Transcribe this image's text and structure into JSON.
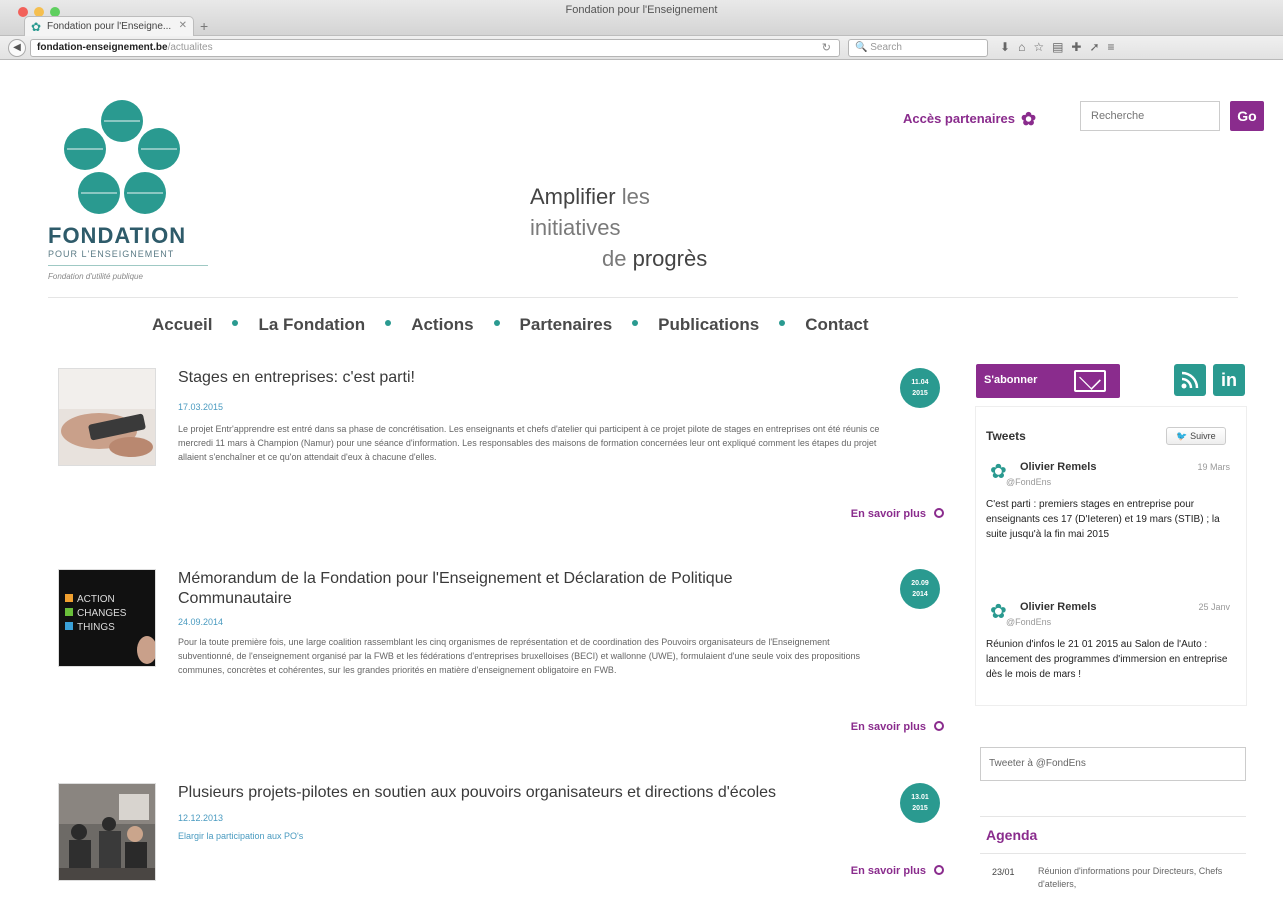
{
  "browser": {
    "window_title": "Fondation pour l'Enseignement",
    "tab_label": "Fondation pour l'Enseigne...",
    "url_host": "fondation-enseignement.be",
    "url_path": "/actualites",
    "search_placeholder": "Search"
  },
  "header": {
    "logo_name": "FONDATION",
    "logo_sub": "POUR L'ENSEIGNEMENT",
    "logo_tag": "Fondation d'utilité publique",
    "tagline_l1_strong": "Amplifier",
    "tagline_l1_rest": " les",
    "tagline_l2": "initiatives",
    "tagline_l3_pre": "de ",
    "tagline_l3_strong": "progrès",
    "partners_label": "Accès partenaires",
    "search_placeholder": "Recherche",
    "go_label": "Go"
  },
  "nav": {
    "items": [
      "Accueil",
      "La Fondation",
      "Actions",
      "Partenaires",
      "Publications",
      "Contact"
    ]
  },
  "articles": [
    {
      "title": "Stages en entreprises: c'est parti!",
      "date": "17.03.2015",
      "badge_l1": "11.04",
      "badge_l2": "2015",
      "body": "Le projet Entr'apprendre est entré dans sa phase de concrétisation. Les enseignants et chefs d'atelier qui participent à ce projet pilote de stages en entreprises ont été réunis ce mercredi 11 mars à Champion (Namur) pour une séance d'information. Les responsables des maisons de formation concernées leur ont expliqué comment les étapes du projet allaient s'enchaîner et ce qu'on attendait d'eux à chacune d'elles.",
      "more": "En savoir plus"
    },
    {
      "title": "Mémorandum de la Fondation pour l'Enseignement et Déclaration de Politique Communautaire",
      "date": "24.09.2014",
      "badge_l1": "20.09",
      "badge_l2": "2014",
      "body": "Pour la toute première fois, une large coalition rassemblant les cinq organismes de représentation et de coordination des Pouvoirs organisateurs de l'Enseignement subventionné, de l'enseignement organisé par la FWB et les fédérations d'entreprises bruxelloises (BECI) et wallonne (UWE), formulaient d'une seule voix des propositions communes, concrètes et cohérentes, sur les grandes priorités en matière d'enseignement obligatoire en FWB.",
      "more": "En savoir plus"
    },
    {
      "title": "Plusieurs projets-pilotes en soutien aux pouvoirs organisateurs et directions d'écoles",
      "date": "12.12.2013",
      "badge_l1": "13.01",
      "badge_l2": "2015",
      "link": "Elargir la participation aux PO's",
      "more": "En savoir plus"
    }
  ],
  "sidebar": {
    "subscribe_label": "S'abonner",
    "rss_label": "RSS",
    "linkedin_label": "in",
    "tweets_title": "Tweets",
    "follow_label": "Suivre",
    "tweets": [
      {
        "name": "Olivier Remels",
        "handle": "@FondEns",
        "date": "19 Mars",
        "text": "C'est parti : premiers stages en entreprise pour enseignants ces 17 (D'Ieteren) et 19 mars (STIB) ; la suite jusqu'à la fin mai 2015"
      },
      {
        "name": "Olivier Remels",
        "handle": "@FondEns",
        "date": "25 Janv",
        "text": "Réunion d'infos le 21 01 2015 au Salon de l'Auto : lancement des programmes d'immersion en entreprise dès le mois de mars !"
      }
    ],
    "tweet_box_label": "Tweeter à @FondEns",
    "agenda_title": "Agenda",
    "agenda_date": "23/01",
    "agenda_text": "Réunion d'informations pour Directeurs, Chefs d'ateliers,"
  },
  "colors": {
    "purple": "#8a2c8d",
    "teal": "#2a9a90"
  }
}
